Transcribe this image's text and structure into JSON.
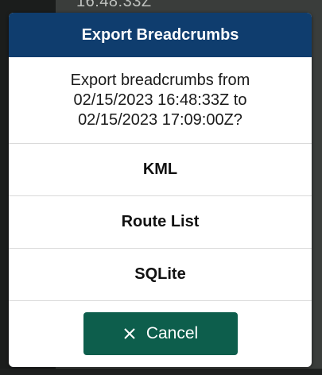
{
  "background": {
    "partial_text": "16:48:33Z"
  },
  "dialog": {
    "title": "Export Breadcrumbs",
    "message": "Export breadcrumbs from\n02/15/2023 16:48:33Z to\n02/15/2023 17:09:00Z?",
    "options": [
      {
        "label": "KML"
      },
      {
        "label": "Route List"
      },
      {
        "label": "SQLite"
      }
    ],
    "cancel_label": "Cancel",
    "cancel_icon": "close-icon"
  },
  "colors": {
    "header": "#0f3d6e",
    "cancel_button": "#0d5e4c"
  }
}
